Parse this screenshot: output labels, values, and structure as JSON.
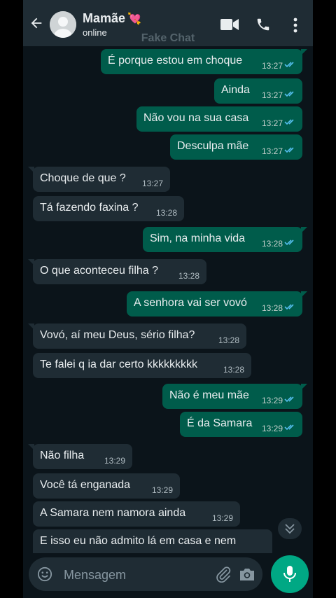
{
  "header": {
    "contact_name": "Mamãe",
    "contact_emoji": "💘",
    "status": "online",
    "watermark": "Fake Chat",
    "icons": [
      "back-arrow-icon",
      "avatar-placeholder-icon",
      "video-call-icon",
      "phone-icon",
      "more-options-icon"
    ]
  },
  "messages": [
    {
      "text": "É porque estou em choque",
      "time": "13:27",
      "direction": "out",
      "read": true
    },
    {
      "text": "Ainda",
      "time": "13:27",
      "direction": "out",
      "read": true
    },
    {
      "text": "Não vou na sua casa",
      "time": "13:27",
      "direction": "out",
      "read": true
    },
    {
      "text": "Desculpa mãe",
      "time": "13:27",
      "direction": "out",
      "read": true
    },
    {
      "text": "Choque de que ?",
      "time": "13:27",
      "direction": "in"
    },
    {
      "text": "Tá fazendo faxina ?",
      "time": "13:28",
      "direction": "in"
    },
    {
      "text": "Sim,  na minha vida",
      "time": "13:28",
      "direction": "out",
      "read": true
    },
    {
      "text": "O que aconteceu filha ?",
      "time": "13:28",
      "direction": "in"
    },
    {
      "text": "A senhora vai ser vovó",
      "time": "13:28",
      "direction": "out",
      "read": true
    },
    {
      "text": "Vovó, aí meu Deus, sério filha?",
      "time": "13:28",
      "direction": "in"
    },
    {
      "text": "Te falei q ia dar certo kkkkkkkkk",
      "time": "13:28",
      "direction": "in"
    },
    {
      "text": "Não é meu mãe",
      "time": "13:29",
      "direction": "out",
      "read": true
    },
    {
      "text": "É da Samara",
      "time": "13:29",
      "direction": "out",
      "read": true
    },
    {
      "text": "Não filha",
      "time": "13:29",
      "direction": "in"
    },
    {
      "text": "Você tá enganada",
      "time": "13:29",
      "direction": "in"
    },
    {
      "text": "A Samara nem namora ainda",
      "time": "13:29",
      "direction": "in"
    },
    {
      "text": "E isso eu não admito lá em casa e nem",
      "time": "",
      "direction": "in"
    }
  ],
  "composer": {
    "placeholder": "Mensagem",
    "icons": [
      "emoji-icon",
      "attach-icon",
      "camera-icon",
      "mic-icon"
    ]
  },
  "colors": {
    "background": "#0b141a",
    "header": "#1f2c34",
    "outgoing_bubble": "#005c4b",
    "incoming_bubble": "#1f2c34",
    "read_ticks": "#53bdeb",
    "accent": "#00a884"
  }
}
